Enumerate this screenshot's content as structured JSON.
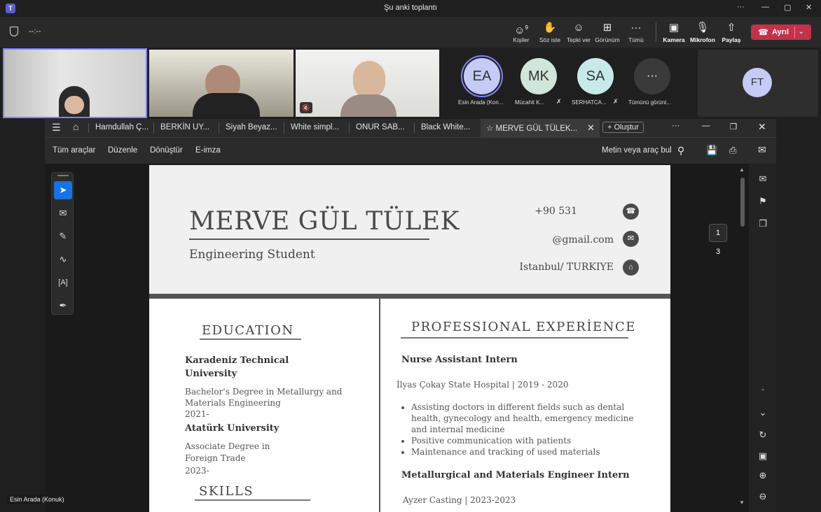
{
  "app": {
    "title": "Şu anki toplantı",
    "timer": "--:--",
    "window_controls": [
      "···",
      "—",
      "▢",
      "✕"
    ]
  },
  "toolbar": {
    "people_count": "9",
    "buttons": [
      {
        "label": "Kişiler",
        "icon": "people-icon"
      },
      {
        "label": "Söz iste",
        "icon": "raise-hand-icon"
      },
      {
        "label": "Tepki ver",
        "icon": "reaction-icon"
      },
      {
        "label": "Görünüm",
        "icon": "view-icon"
      },
      {
        "label": "Tümü",
        "icon": "more-icon"
      },
      {
        "label": "Kamera",
        "icon": "camera-off-icon"
      },
      {
        "label": "Mikrofon",
        "icon": "mic-off-icon"
      },
      {
        "label": "Paylaş",
        "icon": "share-icon"
      }
    ],
    "leave_label": "Ayrıl"
  },
  "participants": {
    "avatars": [
      {
        "initials": "EA",
        "name": "Esin Arada (Kon...",
        "color": "#c5cbf5"
      },
      {
        "initials": "MK",
        "name": "Mücahit K...",
        "color": "#cfe6d8"
      },
      {
        "initials": "SA",
        "name": "SERHATCA...",
        "color": "#c7eae9"
      },
      {
        "initials": "···",
        "name": "Tümünü görünt...",
        "color": "#3a3a3a"
      }
    ],
    "side_avatar": {
      "initials": "FT",
      "color": "#c5cbf5"
    }
  },
  "acrobat": {
    "tabs": [
      "Hamdullah Ç...",
      "BERKİN UY...",
      "Siyah Beyaz...",
      "White simpl...",
      "ONUR SAB...",
      "Black White..."
    ],
    "active_tab": "MERVE GÜL TÜLEK...",
    "create_label": "Oluştur",
    "menu": [
      "Tüm araçlar",
      "Düzenle",
      "Dönüştür",
      "E-imza"
    ],
    "search_label": "Metin veya araç bul",
    "page_current": "1",
    "page_total": "3"
  },
  "cv": {
    "name": "MERVE GÜL TÜLEK",
    "role": "Engineering Student",
    "phone": "+90 531",
    "email": "@gmail.com",
    "location": "Istanbul/ TURKIYE",
    "education_title": "EDUCATION",
    "edu": [
      {
        "school": "Karadeniz Technical University",
        "degree": "Bachelor's Degree in Metallurgy and Materials Engineering",
        "years": "2021-"
      },
      {
        "school": "Atatürk University",
        "degree": "Associate Degree in Foreign Trade",
        "years": "2023-"
      }
    ],
    "skills_title": "SKILLS",
    "experience_title": "PROFESSIONAL EXPERİENCE",
    "jobs": [
      {
        "title": "Nurse Assistant Intern",
        "place": "İlyas Çokay State Hospital | 2019 - 2020",
        "bullets": [
          "Assisting doctors in different fields such as dental health, gynecology and health, emergency medicine and internal medicine",
          "Positive communication with patients",
          "Maintenance and tracking of used materials"
        ]
      },
      {
        "title": "Metallurgical and Materials Engineer Intern",
        "place": "Ayzer Casting | 2023-2023"
      }
    ]
  },
  "caption": "Esin Arada (Konuk)"
}
